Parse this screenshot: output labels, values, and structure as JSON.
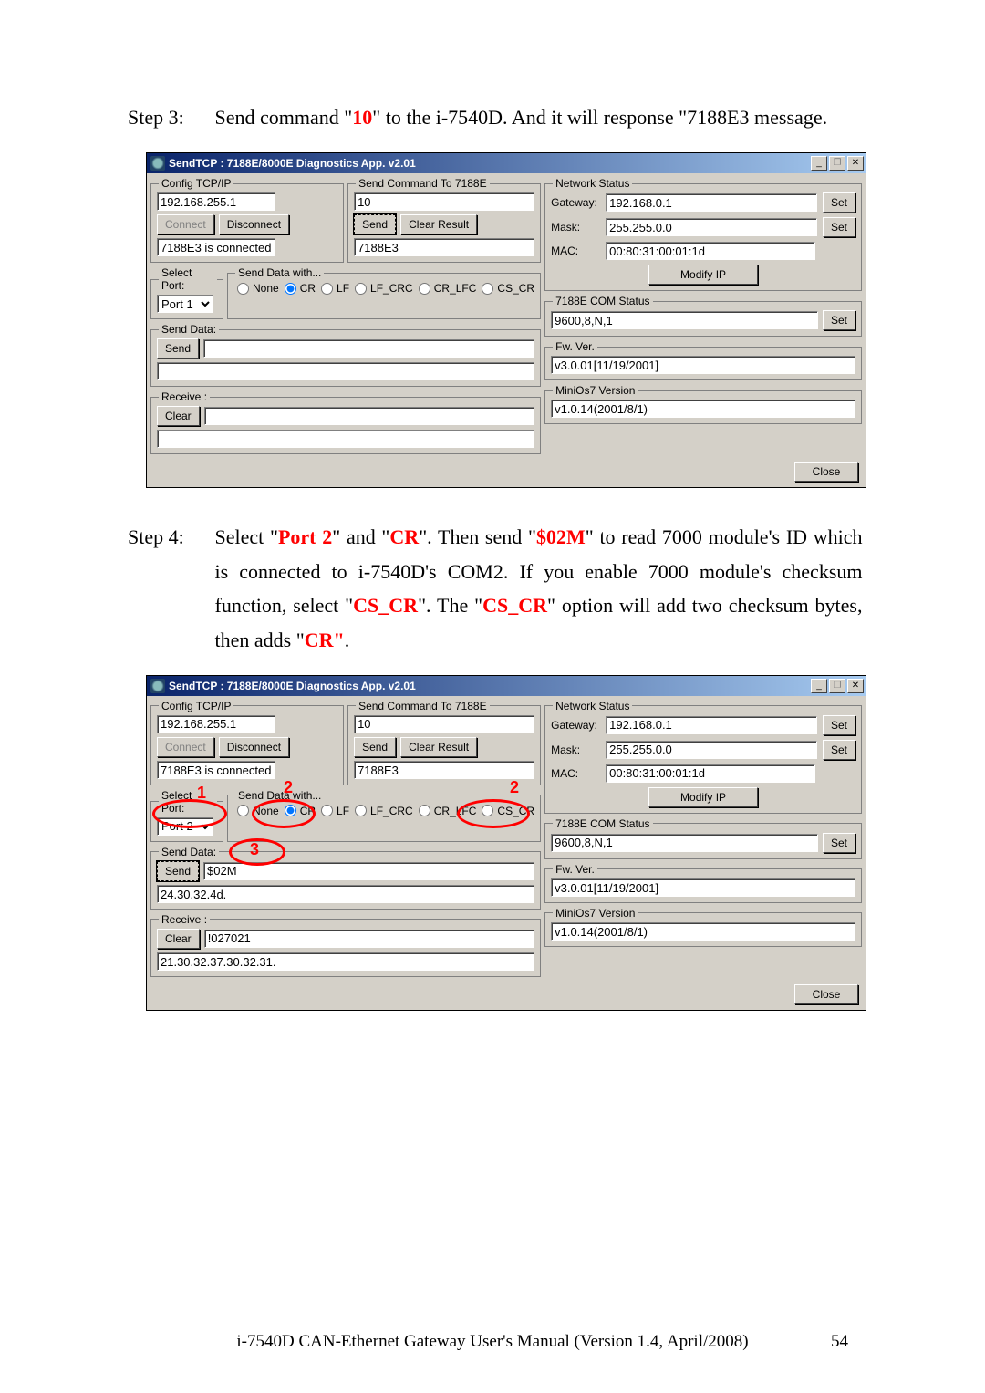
{
  "step3": {
    "label": "Step 3:",
    "pre": "Send command \"",
    "cmd": "10",
    "post": "\" to the i-7540D. And it will response \"7188E3 message."
  },
  "step4": {
    "label": "Step 4:",
    "l1a": "Select \"",
    "port2": "Port 2",
    "l1b": "\" and \"",
    "cr": "CR",
    "l1c": "\". Then send \"",
    "cmd02m": "$02M",
    "l1d": "\" to read 7000 module's ID which is connected to i-7540D's COM2.  If you enable 7000 module's checksum function, select \"",
    "cscr": "CS_CR",
    "l1e": "\". The \"",
    "cscr2": "CS_CR",
    "l1f": "\" option will add two checksum bytes, then adds \"",
    "cr2": "CR\"",
    "l1g": "."
  },
  "app": {
    "title": "SendTCP : 7188E/8000E Diagnostics App. v2.01",
    "minimize": "_",
    "restore": "❐",
    "close_x": "✕"
  },
  "config_tcpip": {
    "legend": "Config TCP/IP",
    "ip": "192.168.255.1",
    "connect": "Connect",
    "disconnect": "Disconnect",
    "status": "7188E3 is connected"
  },
  "send_cmd": {
    "legend": "Send Command To 7188E",
    "value": "10",
    "send": "Send",
    "clear": "Clear Result",
    "result": "7188E3"
  },
  "select_port": {
    "legend": "Select Port:",
    "port_a": "Port 1",
    "port_b": "Port 2"
  },
  "send_data_with": {
    "legend": "Send Data with...",
    "none": "None",
    "cr": "CR",
    "lf": "LF",
    "lfcrc": "LF_CRC",
    "crlfc": "CR_LFC",
    "cscr": "CS_CR"
  },
  "send_data": {
    "legend": "Send Data:",
    "send": "Send",
    "val_a": "",
    "result_a": "",
    "val_b": "$02M",
    "result_b": "24.30.32.4d."
  },
  "receive": {
    "legend": "Receive :",
    "clear": "Clear",
    "val_a": "",
    "data_a": "",
    "val_b": "!027021",
    "data_b": "21.30.32.37.30.32.31."
  },
  "network": {
    "legend": "Network Status",
    "gateway_l": "Gateway:",
    "gateway": "192.168.0.1",
    "mask_l": "Mask:",
    "mask": "255.255.0.0",
    "mac_l": "MAC:",
    "mac": "00:80:31:00:01:1d",
    "set": "Set",
    "modify": "Modify IP"
  },
  "com_status": {
    "legend": "7188E COM Status",
    "val": "9600,8,N,1",
    "set": "Set"
  },
  "fw": {
    "legend": "Fw. Ver.",
    "val": "v3.0.01[11/19/2001]"
  },
  "minios": {
    "legend": "MiniOs7 Version",
    "val": "v1.0.14(2001/8/1)"
  },
  "close": "Close",
  "footer": {
    "text": "i-7540D CAN-Ethernet Gateway User's Manual (Version 1.4, April/2008)",
    "page": "54"
  },
  "annot": {
    "n1": "1",
    "n2": "2",
    "n2b": "2",
    "n3": "3"
  }
}
